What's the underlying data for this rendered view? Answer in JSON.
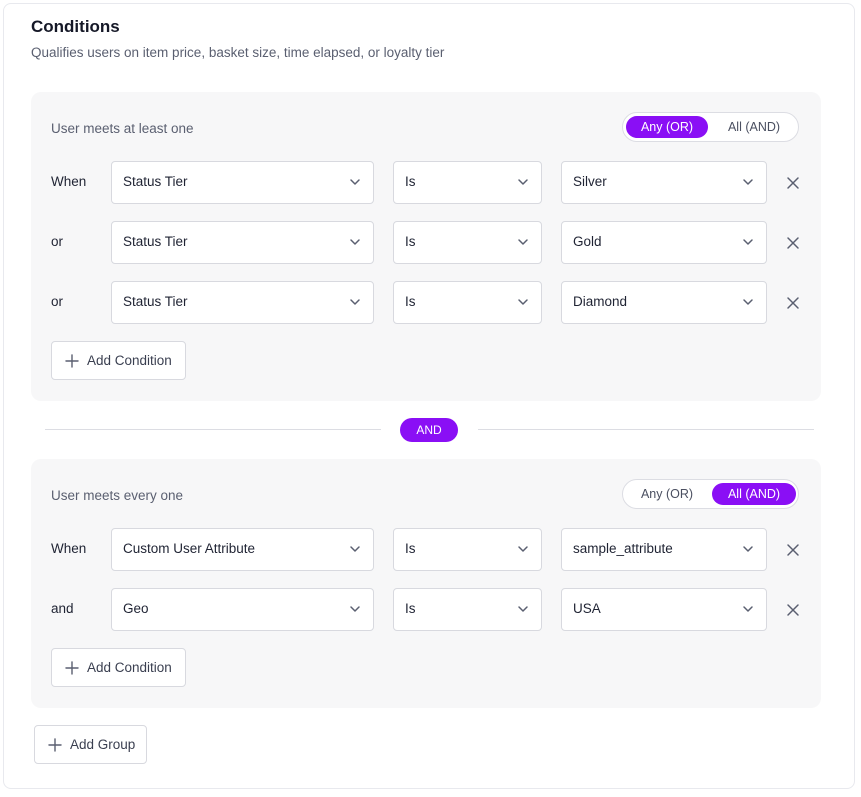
{
  "header": {
    "title": "Conditions",
    "subtitle": "Qualifies users on item price, basket size, time elapsed, or loyalty tier"
  },
  "groups": [
    {
      "label": "User meets at least one",
      "toggle": {
        "any_label": "Any (OR)",
        "all_label": "All (AND)",
        "selected": "any"
      },
      "conditions": [
        {
          "prefix": "When",
          "field": "Status Tier",
          "operator": "Is",
          "value": "Silver"
        },
        {
          "prefix": "or",
          "field": "Status Tier",
          "operator": "Is",
          "value": "Gold"
        },
        {
          "prefix": "or",
          "field": "Status Tier",
          "operator": "Is",
          "value": "Diamond"
        }
      ],
      "add_condition_label": "Add Condition"
    },
    {
      "label": "User meets every one",
      "toggle": {
        "any_label": "Any (OR)",
        "all_label": "All (AND)",
        "selected": "all"
      },
      "conditions": [
        {
          "prefix": "When",
          "field": "Custom User Attribute",
          "operator": "Is",
          "value": "sample_attribute"
        },
        {
          "prefix": "and",
          "field": "Geo",
          "operator": "Is",
          "value": "USA"
        }
      ],
      "add_condition_label": "Add Condition"
    }
  ],
  "group_connector": "AND",
  "add_group_label": "Add Group",
  "colors": {
    "accent": "#8a0ff5",
    "group_bg": "#f7f7f8",
    "border": "#d8d9df"
  }
}
